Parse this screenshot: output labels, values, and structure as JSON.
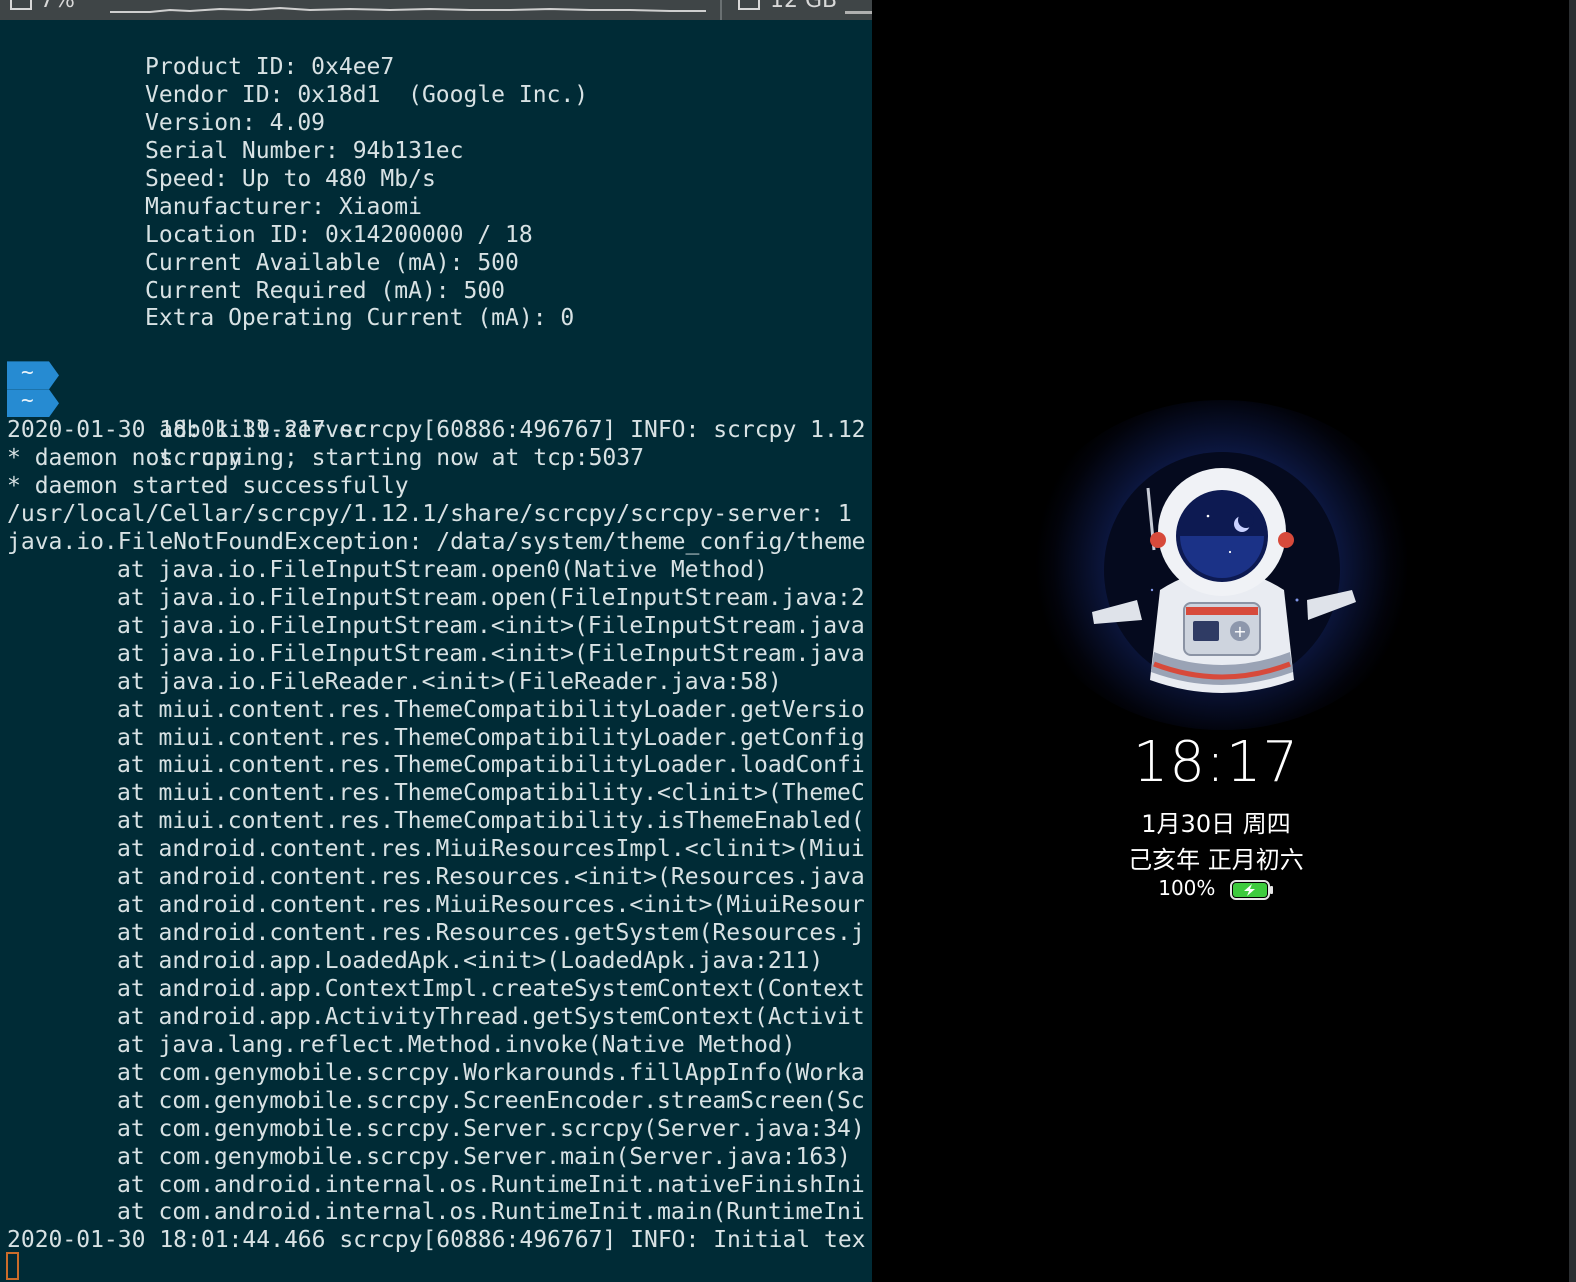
{
  "statusbar": {
    "cpu_label": "7%",
    "mem_label": "12 GB"
  },
  "terminal": {
    "usb_info": [
      "Product ID: 0x4ee7",
      "Vendor ID: 0x18d1  (Google Inc.)",
      "Version: 4.09",
      "Serial Number: 94b131ec",
      "Speed: Up to 480 Mb/s",
      "Manufacturer: Xiaomi",
      "Location ID: 0x14200000 / 18",
      "Current Available (mA): 500",
      "Current Required (mA): 500",
      "Extra Operating Current (mA): 0"
    ],
    "prompt_symbol": "~",
    "commands": [
      "adb kill-server",
      "scrcpy"
    ],
    "log_lines": [
      "2020-01-30 18:01:39.217 scrcpy[60886:496767] INFO: scrcpy 1.12",
      "* daemon not running; starting now at tcp:5037",
      "* daemon started successfully",
      "/usr/local/Cellar/scrcpy/1.12.1/share/scrcpy/scrcpy-server: 1",
      "java.io.FileNotFoundException: /data/system/theme_config/theme"
    ],
    "stack_trace": [
      "at java.io.FileInputStream.open0(Native Method)",
      "at java.io.FileInputStream.open(FileInputStream.java:2",
      "at java.io.FileInputStream.<init>(FileInputStream.java",
      "at java.io.FileInputStream.<init>(FileInputStream.java",
      "at java.io.FileReader.<init>(FileReader.java:58)",
      "at miui.content.res.ThemeCompatibilityLoader.getVersio",
      "at miui.content.res.ThemeCompatibilityLoader.getConfig",
      "at miui.content.res.ThemeCompatibilityLoader.loadConfi",
      "at miui.content.res.ThemeCompatibility.<clinit>(ThemeC",
      "at miui.content.res.ThemeCompatibility.isThemeEnabled(",
      "at android.content.res.MiuiResourcesImpl.<clinit>(Miui",
      "at android.content.res.Resources.<init>(Resources.java",
      "at android.content.res.MiuiResources.<init>(MiuiResour",
      "at android.content.res.Resources.getSystem(Resources.j",
      "at android.app.LoadedApk.<init>(LoadedApk.java:211)",
      "at android.app.ContextImpl.createSystemContext(Context",
      "at android.app.ActivityThread.getSystemContext(Activit",
      "at java.lang.reflect.Method.invoke(Native Method)",
      "at com.genymobile.scrcpy.Workarounds.fillAppInfo(Worka",
      "at com.genymobile.scrcpy.ScreenEncoder.streamScreen(Sc",
      "at com.genymobile.scrcpy.Server.scrcpy(Server.java:34)",
      "at com.genymobile.scrcpy.Server.main(Server.java:163)",
      "at com.android.internal.os.RuntimeInit.nativeFinishIni",
      "at com.android.internal.os.RuntimeInit.main(RuntimeIni"
    ],
    "final_line": "2020-01-30 18:01:44.466 scrcpy[60886:496767] INFO: Initial tex"
  },
  "phone": {
    "time": "18:17",
    "date": "1月30日 周四",
    "lunar_date": "己亥年 正月初六",
    "battery_percent": "100%",
    "battery_level": 1.0,
    "battery_charging": true,
    "colors": {
      "battery_fill": "#3ecb3e",
      "wallpaper_glow": "#3a5ece"
    }
  }
}
